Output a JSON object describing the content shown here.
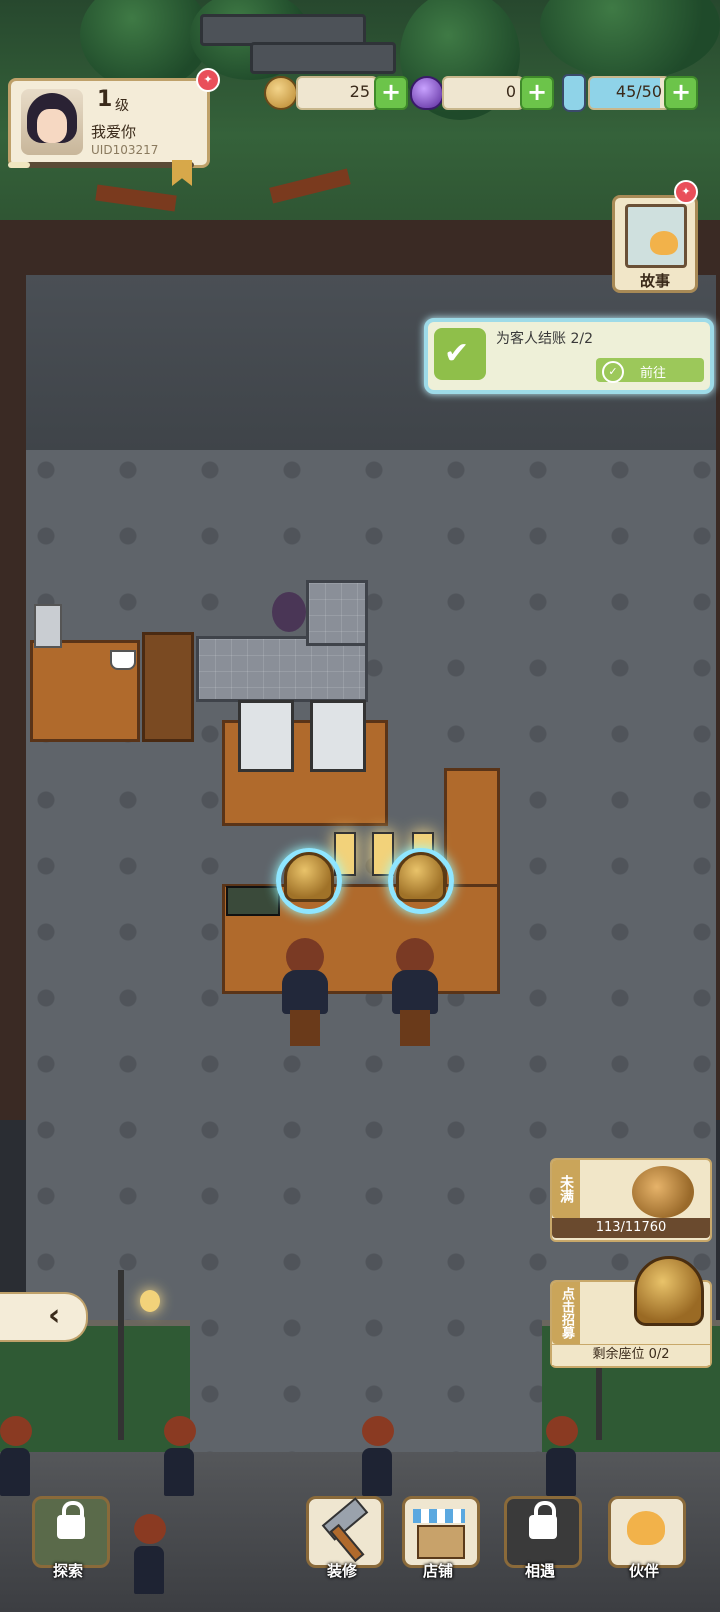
{
  "profile": {
    "level": "1",
    "level_unit": "级",
    "name": "我爱你",
    "uid": "UID103217",
    "xp_fraction": 0.12
  },
  "resources": [
    {
      "name": "coins",
      "icon": "coin-icon",
      "value": "25"
    },
    {
      "name": "gems",
      "icon": "gem-egg-icon",
      "value": "0"
    },
    {
      "name": "energy",
      "icon": "potion-bottle-icon",
      "value": "45/50"
    }
  ],
  "story": {
    "label": "故事"
  },
  "quest": {
    "text": "为客人结账 2/2",
    "go_label": "前往"
  },
  "satisfaction": {
    "tag": "未满",
    "count": "113/11760"
  },
  "recruit": {
    "tag": "点击招募",
    "seats": "剩余座位 0/2"
  },
  "nav": {
    "explore": "探索",
    "renovate": "装修",
    "shop": "店铺",
    "meet": "相遇",
    "partner": "伙伴"
  },
  "colors": {
    "accent_green": "#6cc44a",
    "notification_red": "#e94f5a",
    "panel_cream": "#f4ecd8",
    "quest_glow": "#9edbe8"
  }
}
